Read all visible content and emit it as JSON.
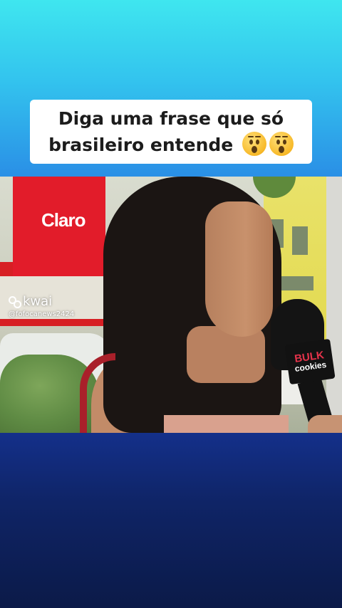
{
  "caption": {
    "line1": "Diga uma frase que só",
    "line2": "brasileiro entende",
    "emoji": "hushed-face-emoji"
  },
  "video": {
    "store_sign": "Claro",
    "mic_brand": "BULK",
    "mic_sub": "cookies",
    "watermark_app": "kwai",
    "watermark_handle": "@fofocanews2424"
  },
  "colors": {
    "top_gradient_start": "#3fe6ef",
    "top_gradient_end": "#2a8fe6",
    "bottom_bg": "#0f2466",
    "caption_bg": "#ffffff"
  }
}
